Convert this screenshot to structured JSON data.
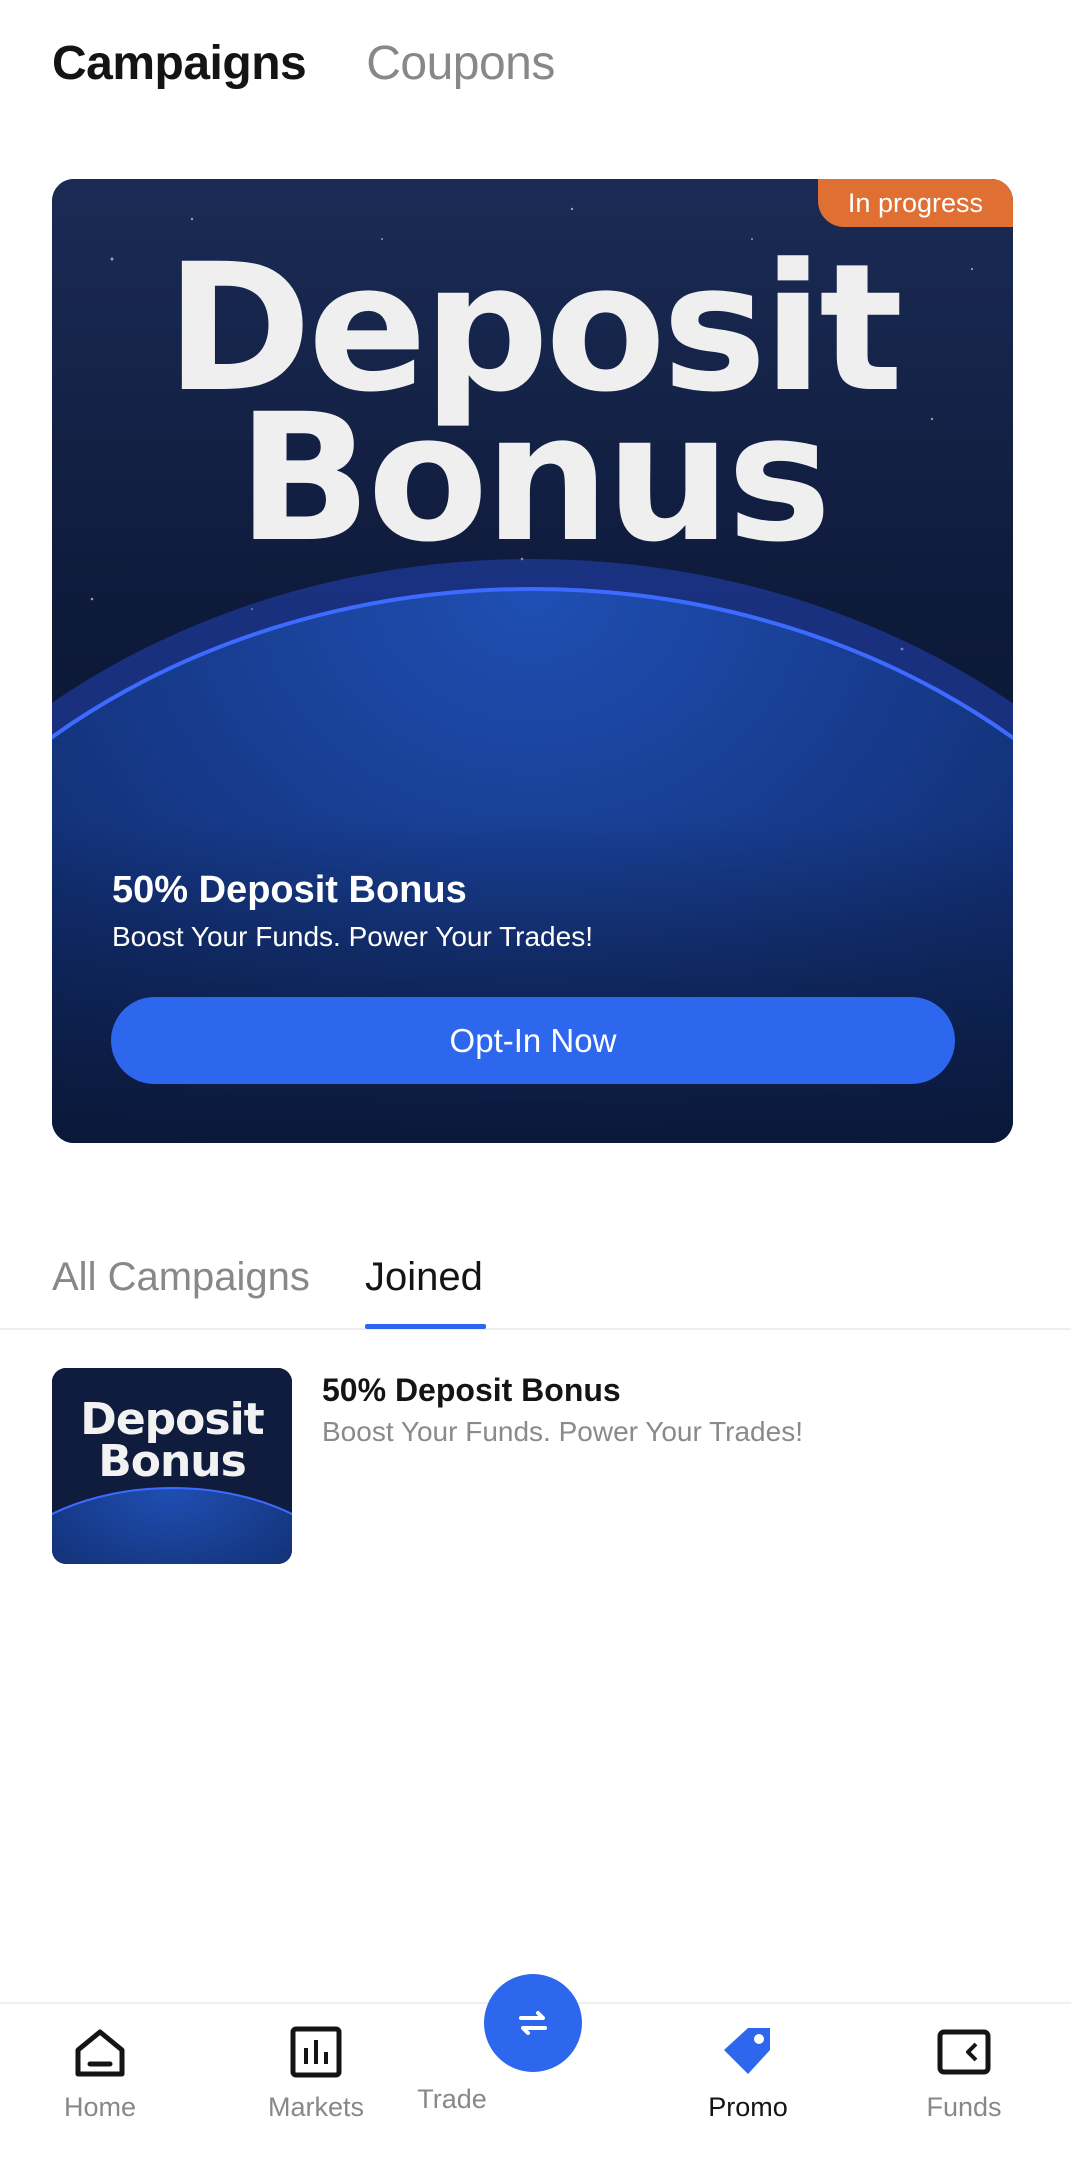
{
  "top_tabs": {
    "campaigns": "Campaigns",
    "coupons": "Coupons"
  },
  "hero": {
    "badge": "In progress",
    "headline_line1": "Deposit",
    "headline_line2": "Bonus",
    "title": "50% Deposit Bonus",
    "subtitle": "Boost Your Funds. Power Your Trades!",
    "cta": "Opt-In Now"
  },
  "sub_tabs": {
    "all": "All Campaigns",
    "joined": "Joined",
    "selected": "Joined"
  },
  "list": [
    {
      "thumb_line1": "Deposit",
      "thumb_line2": "Bonus",
      "title": "50% Deposit Bonus",
      "subtitle": "Boost Your Funds. Power Your Trades!"
    }
  ],
  "nav": {
    "home": "Home",
    "markets": "Markets",
    "trade": "Trade",
    "promo": "Promo",
    "funds": "Funds",
    "active": "Promo"
  },
  "colors": {
    "accent": "#2d67ee",
    "badge": "#e06f33",
    "card_bg": "#0b1836",
    "text_primary": "#141414",
    "text_secondary": "#888888"
  },
  "icons": {
    "home": "home-icon",
    "markets": "bar-chart-icon",
    "trade": "swap-arrows-icon",
    "promo": "tag-icon",
    "funds": "wallet-icon"
  }
}
